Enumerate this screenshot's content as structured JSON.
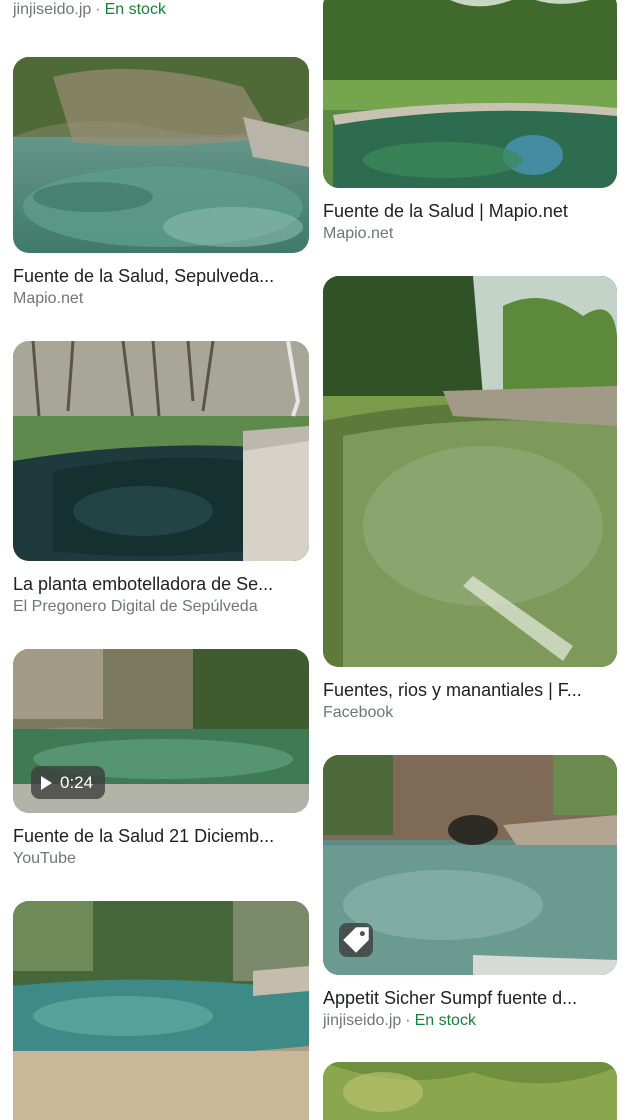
{
  "results": {
    "left": [
      {
        "title": "",
        "source": "jinjiseido.jp",
        "stock": "En stock"
      },
      {
        "title": "Fuente de la Salud, Sepulveda...",
        "source": "Mapio.net"
      },
      {
        "title": "La planta embotelladora de Se...",
        "source": "El Pregonero Digital de Sepúlveda"
      },
      {
        "title": "Fuente de la Salud 21 Diciemb...",
        "source": "YouTube",
        "duration": "0:24"
      },
      {
        "title": "",
        "source": ""
      }
    ],
    "right": [
      {
        "title": "Fuente de la Salud | Mapio.net",
        "source": "Mapio.net"
      },
      {
        "title": "Fuentes, rios y manantiales | F...",
        "source": "Facebook"
      },
      {
        "title": "Appetit Sicher Sumpf fuente d...",
        "source": "jinjiseido.jp",
        "stock": "En stock"
      }
    ]
  },
  "separator": "·",
  "colors": {
    "title": "#202124",
    "source": "#70757a",
    "stock": "#188038"
  },
  "icons": {
    "play": "play-icon",
    "tag": "tag-icon"
  }
}
